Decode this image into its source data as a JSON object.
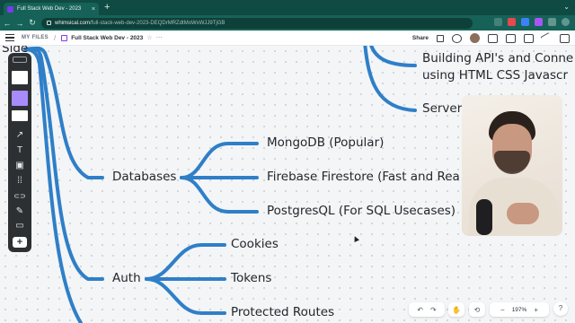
{
  "browser": {
    "tab_title": "Full Stack Web Dev - 2023",
    "tab_close": "×",
    "new_tab": "+",
    "url_domain": "whimsical.com",
    "url_path": "/full-stack-web-dev-2023-DEQDrMRZdtMoWxWJJ9TjGB",
    "back": "←",
    "forward": "→",
    "reload": "↻"
  },
  "app": {
    "menu_label": "MY FILES",
    "separator": "/",
    "board_title": "Full Stack Web Dev - 2023",
    "star_icon": "☆",
    "more_icon": "⋯",
    "share_label": "Share"
  },
  "mindmap": {
    "root_partial": "Side",
    "branch_color": "#2f7fc8",
    "nodes": {
      "databases": "Databases",
      "mongodb": "MongoDB (Popular)",
      "firebase": "Firebase Firestore (Fast and Rea",
      "postgres": "PostgresQL (For SQL Usecases)",
      "auth": "Auth",
      "cookies": "Cookies",
      "tokens": "Tokens",
      "protected": "Protected Routes",
      "apis_line1": "Building API's and Conne",
      "apis_line2": "using HTML CSS Javascr",
      "server": "Server"
    }
  },
  "toolbar": {
    "arrow_icon": "↗",
    "text_icon": "T",
    "image_icon": "▣",
    "grid_icon": "⁞⁞",
    "link_icon": "⊂⊃",
    "pen_icon": "✎",
    "section_icon": "▭",
    "add_icon": "+"
  },
  "controls": {
    "undo": "↶",
    "redo": "↷",
    "hand": "✋",
    "history": "⟲",
    "zoom_out": "−",
    "zoom_level": "197%",
    "zoom_in": "+",
    "help": "?"
  }
}
